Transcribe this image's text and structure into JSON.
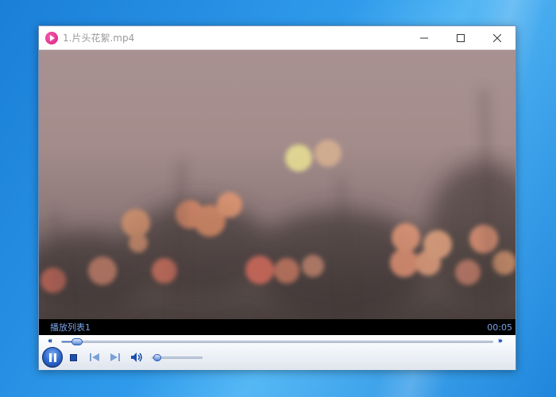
{
  "window": {
    "title": "1.片头花絮.mp4",
    "app_icon": "media-player-icon",
    "buttons": {
      "minimize": "—",
      "maximize": "☐",
      "close": "✕"
    }
  },
  "video": {
    "state": "playing"
  },
  "infobar": {
    "playlist_label": "播放列表1",
    "time": "00:05"
  },
  "controls": {
    "seek_progress": 0.03,
    "volume_level": 0.05,
    "icons": {
      "rewind": "⏴⏴",
      "forward": "⏵⏵",
      "prev": "⏮",
      "next": "⏭",
      "volume": "🔊"
    }
  },
  "colors": {
    "accent": "#2b64c9",
    "time_text": "#7aa2e6",
    "desktop": "#1a7fd8"
  }
}
